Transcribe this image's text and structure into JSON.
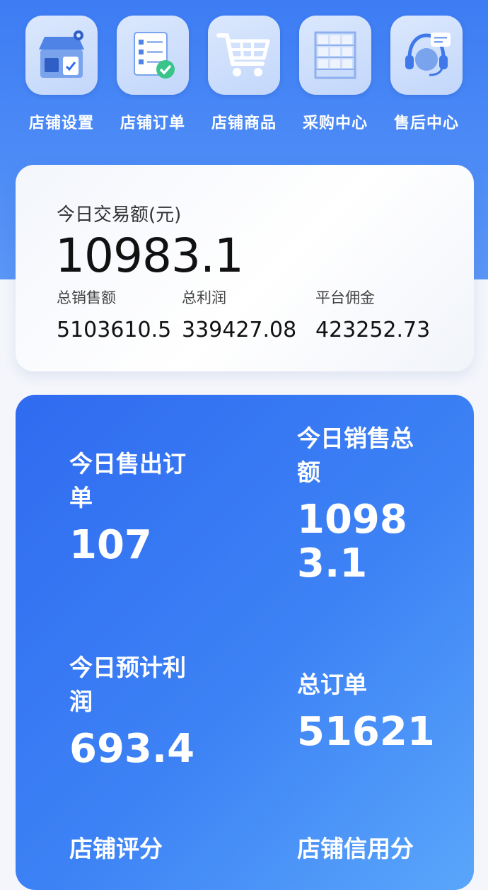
{
  "nav": {
    "items": [
      {
        "label": "店铺设置",
        "icon": "store-settings-icon"
      },
      {
        "label": "店铺订单",
        "icon": "order-checklist-icon"
      },
      {
        "label": "店铺商品",
        "icon": "shopping-cart-icon"
      },
      {
        "label": "采购中心",
        "icon": "warehouse-shelf-icon"
      },
      {
        "label": "售后中心",
        "icon": "headset-support-icon"
      }
    ]
  },
  "summary": {
    "title": "今日交易额(元)",
    "value": "10983.1",
    "metrics": [
      {
        "label": "总销售额",
        "value": "5103610.5"
      },
      {
        "label": "总利润",
        "value": "339427.08"
      },
      {
        "label": "平台佣金",
        "value": "423252.73"
      }
    ]
  },
  "stats": {
    "today_orders": {
      "label": "今日售出订单",
      "value": "107"
    },
    "today_sales": {
      "label": "今日销售总额",
      "value": "10983.1"
    },
    "today_profit": {
      "label": "今日预计利润",
      "value": "693.4"
    },
    "total_orders": {
      "label": "总订单",
      "value": "51621"
    },
    "store_rating": {
      "label": "店铺评分"
    },
    "store_credit": {
      "label": "店铺信用分"
    }
  },
  "colors": {
    "header_blue": "#3d7cf3",
    "card_gradient_start": "#2f6bf0",
    "card_gradient_end": "#5aa6fb"
  }
}
